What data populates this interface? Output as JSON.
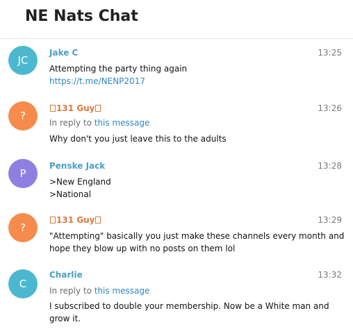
{
  "chat": {
    "title": "NE Nats Chat"
  },
  "colors": {
    "teal": "#4cb8cf",
    "orange": "#f58c4b",
    "purple": "#8e7fe1",
    "link": "#2f86c4"
  },
  "messages": [
    {
      "avatar": "JC",
      "sender": "Jake C",
      "time": "13:25",
      "lines": [
        "Attempting the party thing again"
      ],
      "link": "https://t.me/NENP2017"
    },
    {
      "avatar": "?",
      "sender": "131 Guy",
      "sender_glyphs": "box-glyph",
      "time": "13:26",
      "reply_prefix": "In reply to ",
      "reply_link": "this message",
      "lines": [
        "Why don't you just leave this to the adults"
      ]
    },
    {
      "avatar": "P",
      "sender": "Penske Jack",
      "time": "13:28",
      "lines": [
        ">New England",
        ">National"
      ]
    },
    {
      "avatar": "?",
      "sender": "131 Guy",
      "sender_glyphs": "box-glyph",
      "time": "13:29",
      "lines": [
        "\"Attempting\" basically you just make these channels every month and",
        "hope they blow up with no posts on them lol"
      ]
    },
    {
      "avatar": "C",
      "sender": "Charlie",
      "time": "13:32",
      "reply_prefix": "In reply to ",
      "reply_link": "this message",
      "lines": [
        "I subscribed to double your membership. Now be a White man and",
        "grow it."
      ]
    }
  ]
}
